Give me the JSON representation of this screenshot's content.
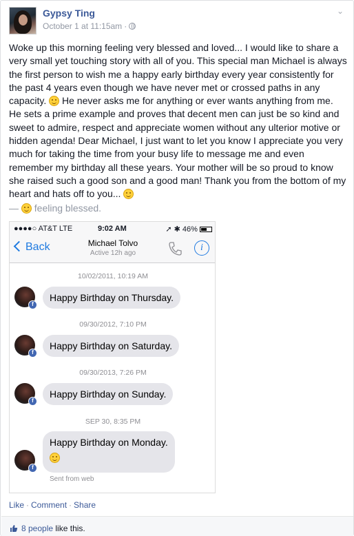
{
  "post": {
    "author": "Gypsy Ting",
    "timestamp": "October 1 at 11:15am",
    "body": "Woke up this morning feeling very blessed and loved... I would like to share a very small yet touching story with all of you. This special man Michael is always the first person to wish me a happy early birthday every year consistently for the past 4 years even though we have never met or crossed paths in any capacity.",
    "body2": "He never asks me for anything or ever wants anything from me. He sets a prime example and proves that decent men can just be so kind and sweet to admire, respect and appreciate women without any ulterior motive or hidden agenda! Dear Michael, I just want to let you know I appreciate you very much for taking the time from your busy life to message me and even remember my birthday all these years. Your mother will be so proud to know she raised such a good son and a good man! Thank you from the bottom of my heart and hats off to you...",
    "feeling_prefix": "—",
    "feeling": "feeling blessed."
  },
  "screenshot": {
    "status": {
      "carrier": "●●●●○ AT&T  LTE",
      "time": "9:02 AM",
      "battery": "46%"
    },
    "nav": {
      "back": "Back",
      "name": "Michael Tolvo",
      "active": "Active 12h ago"
    },
    "messages": [
      {
        "time": "10/02/2011, 10:19 AM",
        "text": "Happy Birthday on Thursday."
      },
      {
        "time": "09/30/2012, 7:10 PM",
        "text": "Happy Birthday on Saturday."
      },
      {
        "time": "09/30/2013, 7:26 PM",
        "text": "Happy Birthday on Sunday."
      },
      {
        "time": "SEP 30, 8:35 PM",
        "text": "Happy Birthday on Monday."
      }
    ],
    "sent_from": "Sent from web"
  },
  "actions": {
    "like": "Like",
    "comment": "Comment",
    "share": "Share"
  },
  "likes": {
    "count": "8 people",
    "suffix": "like this."
  }
}
